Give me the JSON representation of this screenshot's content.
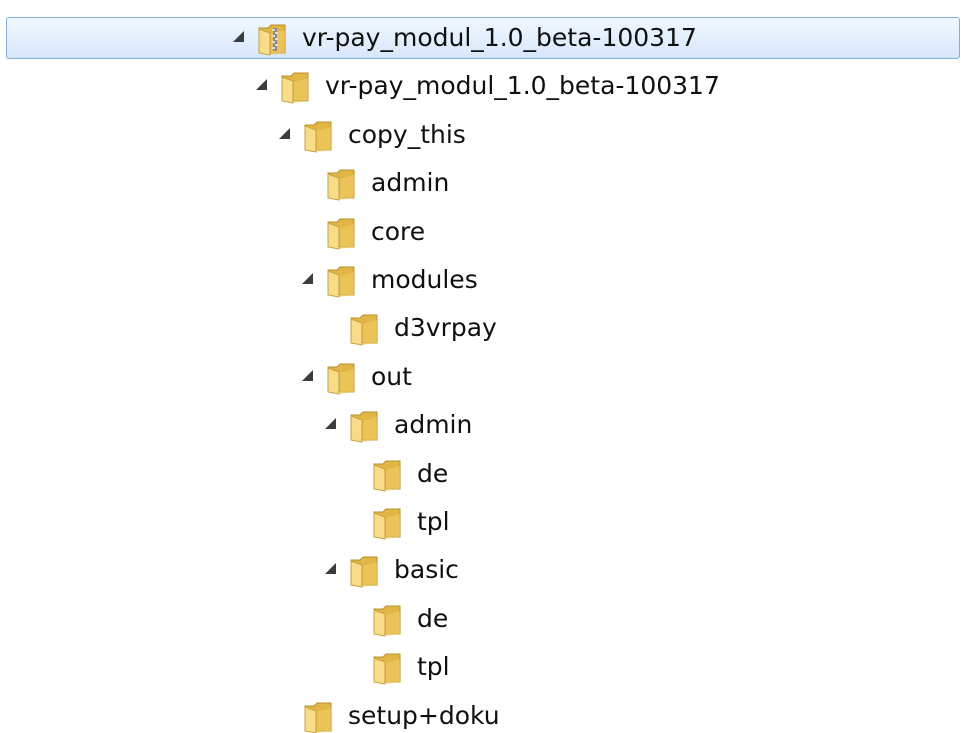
{
  "tree": {
    "items": [
      {
        "id": "root-zip",
        "label": "vr-pay_modul_1.0_beta-100317",
        "depth": 0,
        "expanded": true,
        "icon": "zip-folder-icon",
        "selected": true
      },
      {
        "id": "root-folder",
        "label": "vr-pay_modul_1.0_beta-100317",
        "depth": 1,
        "expanded": true,
        "icon": "folder-icon"
      },
      {
        "id": "copy-this",
        "label": "copy_this",
        "depth": 2,
        "expanded": true,
        "icon": "folder-icon"
      },
      {
        "id": "admin",
        "label": "admin",
        "depth": 3,
        "expanded": false,
        "icon": "folder-icon"
      },
      {
        "id": "core",
        "label": "core",
        "depth": 3,
        "expanded": false,
        "icon": "folder-icon"
      },
      {
        "id": "modules",
        "label": "modules",
        "depth": 3,
        "expanded": true,
        "icon": "folder-icon"
      },
      {
        "id": "d3vrpay",
        "label": "d3vrpay",
        "depth": 4,
        "expanded": false,
        "icon": "folder-icon"
      },
      {
        "id": "out",
        "label": "out",
        "depth": 3,
        "expanded": true,
        "icon": "folder-icon"
      },
      {
        "id": "out-admin",
        "label": "admin",
        "depth": 4,
        "expanded": true,
        "icon": "folder-icon"
      },
      {
        "id": "out-admin-de",
        "label": "de",
        "depth": 5,
        "expanded": false,
        "icon": "folder-icon"
      },
      {
        "id": "out-admin-tpl",
        "label": "tpl",
        "depth": 5,
        "expanded": false,
        "icon": "folder-icon"
      },
      {
        "id": "basic",
        "label": "basic",
        "depth": 4,
        "expanded": true,
        "icon": "folder-icon"
      },
      {
        "id": "basic-de",
        "label": "de",
        "depth": 5,
        "expanded": false,
        "icon": "folder-icon"
      },
      {
        "id": "basic-tpl",
        "label": "tpl",
        "depth": 5,
        "expanded": false,
        "icon": "folder-icon"
      },
      {
        "id": "setup-doku",
        "label": "setup+doku",
        "depth": 2,
        "expanded": false,
        "icon": "folder-icon"
      }
    ]
  },
  "colors": {
    "selection_border": "#84acdd",
    "folder_back": "#e2b645",
    "folder_front": "#f8dc8a",
    "arrow": "#3c3c3c",
    "text": "#101010"
  }
}
